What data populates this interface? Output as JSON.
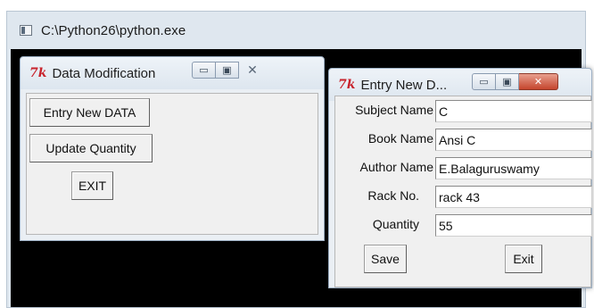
{
  "console": {
    "title": "C:\\Python26\\python.exe"
  },
  "data_modification": {
    "title": "Data Modification",
    "logo": "7k",
    "buttons": {
      "entry_new": "Entry New DATA",
      "update_quantity": "Update Quantity",
      "exit": "EXIT"
    }
  },
  "entry_new": {
    "title": "Entry New D...",
    "logo": "7k",
    "fields": [
      {
        "label": "Subject Name",
        "value": "C"
      },
      {
        "label": "Book Name",
        "value": "Ansi C"
      },
      {
        "label": "Author Name",
        "value": "E.Balaguruswamy"
      },
      {
        "label": "Rack No.",
        "value": "rack 43"
      },
      {
        "label": "Quantity",
        "value": "55"
      }
    ],
    "buttons": {
      "save": "Save",
      "exit": "Exit"
    }
  },
  "icons": {
    "minimize": "minimize-icon",
    "maximize": "maximize-icon",
    "close": "close-icon"
  }
}
